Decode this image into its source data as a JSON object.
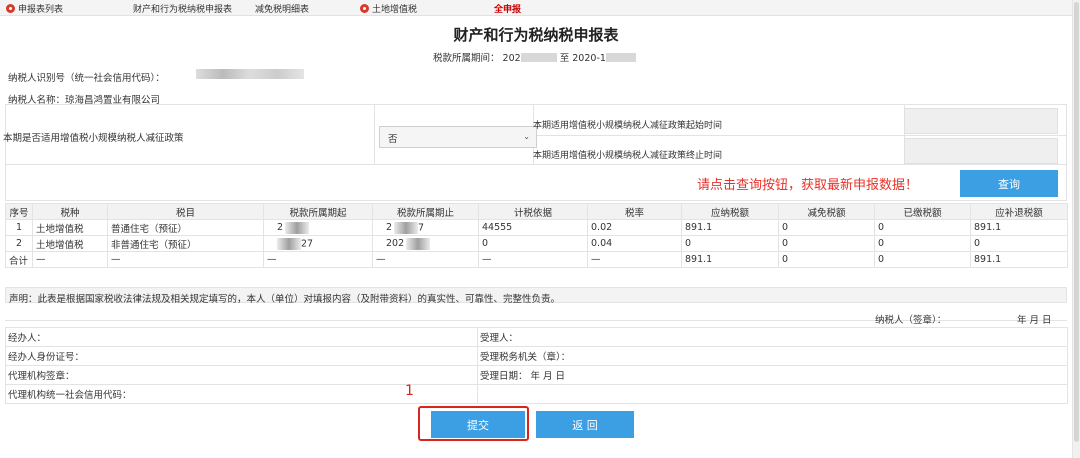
{
  "nav": {
    "items": [
      {
        "label": "申报表列表",
        "icon": "record-dot-icon"
      },
      {
        "label": "财产和行为税纳税申报表"
      },
      {
        "label": "减免税明细表"
      },
      {
        "label": "土地增值税",
        "icon": "record-dot-icon"
      },
      {
        "label": "全申报",
        "active": true
      }
    ]
  },
  "form": {
    "title": "财产和行为税纳税申报表",
    "period_label": "税款所属期间：",
    "period_start": "202",
    "period_to": "至",
    "period_end": "2020-1"
  },
  "taxpayer": {
    "id_label": "纳税人识别号（统一社会信用代码）：",
    "name_label": "纳税人名称：琼海昌鸿置业有限公司"
  },
  "policy": {
    "question": "本期是否适用增值税小规模纳税人减征政策",
    "selected": "否",
    "start_label": "本期适用增值税小规模纳税人减征政策起始时间",
    "end_label": "本期适用增值税小规模纳税人减征政策终止时间"
  },
  "query": {
    "message": "请点击查询按钮，获取最新申报数据！",
    "button": "查询"
  },
  "table": {
    "headers": [
      "序号",
      "税种",
      "税目",
      "税款所属期起",
      "税款所属期止",
      "计税依据",
      "税率",
      "应纳税额",
      "减免税额",
      "已缴税额",
      "应补退税额"
    ],
    "rows": [
      {
        "no": "1",
        "tax": "土地增值税",
        "item": "普通住宅（预征）",
        "start": "2",
        "end": "2",
        "end_suffix": "7",
        "basis": "44555",
        "rate": "0.02",
        "payable": "891.1",
        "relief": "0",
        "paid": "0",
        "due": "891.1"
      },
      {
        "no": "2",
        "tax": "土地增值税",
        "item": "非普通住宅（预征）",
        "start": "",
        "start_suffix": "27",
        "end": "202",
        "end_suffix": "",
        "basis": "0",
        "rate": "0.04",
        "payable": "0",
        "relief": "0",
        "paid": "0",
        "due": "0"
      }
    ],
    "total": {
      "label": "合计",
      "dash": "—",
      "payable": "891.1",
      "relief": "0",
      "paid": "0",
      "due": "891.1"
    }
  },
  "statement": "声明：此表是根据国家税收法律法规及相关规定填写的，本人（单位）对填报内容（及附带资料）的真实性、可靠性、完整性负责。",
  "sign": {
    "taxpayer_label": "纳税人（签章）：",
    "date": "年 月 日"
  },
  "signature": {
    "agent": "经办人：",
    "receiver": "受理人：",
    "agent_id": "经办人身份证号：",
    "tax_office": "受理税务机关（章）：",
    "agency_seal": "代理机构签章：",
    "accept_date": "受理日期：   年 月 日",
    "agency_code": "代理机构统一社会信用代码："
  },
  "annotation": "1",
  "buttons": {
    "submit": "提交",
    "back": "返 回"
  }
}
